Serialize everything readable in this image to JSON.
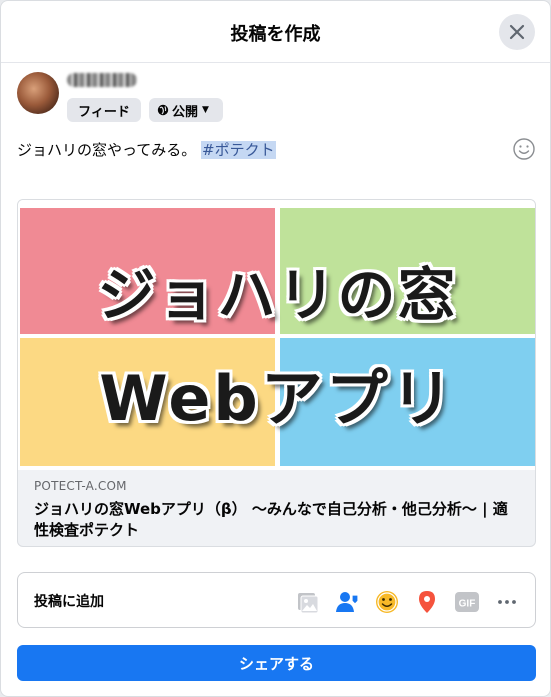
{
  "dialog": {
    "title": "投稿を作成"
  },
  "composer": {
    "audience_label": "フィード",
    "privacy_label": "公開",
    "post_text": "ジョハリの窓やってみる。",
    "hashtag": "#ポテクト"
  },
  "link_preview": {
    "image_line1": "ジョハリの窓",
    "image_line2": "Webアプリ",
    "image_colors": [
      "#f08a94",
      "#bfe29a",
      "#fcd983",
      "#7fcff0"
    ],
    "domain": "POTECT-A.COM",
    "title": "ジョハリの窓Webアプリ（β） 〜みんなで自己分析・他己分析〜 | 適性検査ポテクト"
  },
  "add_to_post": {
    "label": "投稿に追加",
    "icons": [
      "photo-video-icon",
      "tag-people-icon",
      "feeling-icon",
      "check-in-icon",
      "gif-icon",
      "more-icon"
    ]
  },
  "share_button": {
    "label": "シェアする",
    "color": "#1877f2"
  }
}
